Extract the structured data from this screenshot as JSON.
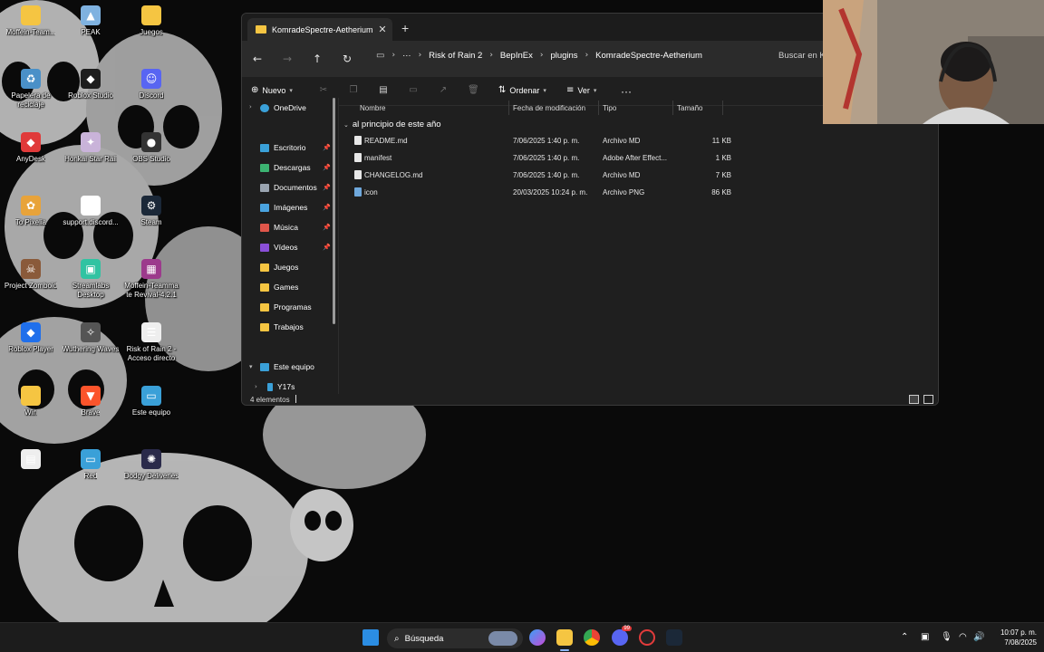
{
  "desktop": {
    "icons": [
      {
        "label": "Moffein-Team...",
        "color": "#f5c542",
        "glyph": ""
      },
      {
        "label": "PEAK",
        "color": "#7fb2e0",
        "glyph": "▲"
      },
      {
        "label": "Juegos",
        "color": "#f5c542",
        "glyph": ""
      },
      {
        "label": "Papelera de reciclaje",
        "color": "#4a90c8",
        "glyph": "♻"
      },
      {
        "label": "Roblox Studio",
        "color": "#1d1d1d",
        "glyph": "◆"
      },
      {
        "label": "Discord",
        "color": "#5865f2",
        "glyph": "☺"
      },
      {
        "label": "AnyDesk",
        "color": "#e03a3a",
        "glyph": "◆"
      },
      {
        "label": "Honkai Star Rail",
        "color": "#c9b3d9",
        "glyph": "✦"
      },
      {
        "label": "OBS Studio",
        "color": "#333333",
        "glyph": "●"
      },
      {
        "label": "To Pixelia",
        "color": "#e8a33a",
        "glyph": "✿"
      },
      {
        "label": "support.discord...",
        "color": "#ffffff",
        "glyph": "●"
      },
      {
        "label": "Steam",
        "color": "#1b2838",
        "glyph": "⚙"
      },
      {
        "label": "Project Zomboid",
        "color": "#8a5a3a",
        "glyph": "☠"
      },
      {
        "label": "Streamlabs Desktop",
        "color": "#31c3a2",
        "glyph": "▣"
      },
      {
        "label": "Moffein-Teamma te Revival-4.2.1",
        "color": "#9c3a8c",
        "glyph": "▦"
      },
      {
        "label": "Roblox Player",
        "color": "#1f6feb",
        "glyph": "◆"
      },
      {
        "label": "Wuthering Waves",
        "color": "#555555",
        "glyph": "✧"
      },
      {
        "label": "Risk of Rain 2 - Acceso directo",
        "color": "#eeeeee",
        "glyph": "☰"
      },
      {
        "label": "Win",
        "color": "#f5c542",
        "glyph": ""
      },
      {
        "label": "Brave",
        "color": "#fb542b",
        "glyph": "▼"
      },
      {
        "label": "Este equipo",
        "color": "#3aa0d8",
        "glyph": "▭"
      },
      {
        "label": "",
        "color": "#eeeeee",
        "glyph": "▤"
      },
      {
        "label": "Red",
        "color": "#3aa0d8",
        "glyph": "▭"
      },
      {
        "label": "Dodgy Deliveries",
        "color": "#2a2a4a",
        "glyph": "✺"
      }
    ]
  },
  "explorer": {
    "tab_title": "KomradeSpectre-Aetherium",
    "tab_close": "✕",
    "new_tab": "+",
    "breadcrumbs": [
      "Risk of Rain 2",
      "BepInEx",
      "plugins",
      "KomradeSpectre-Aetherium"
    ],
    "breadcrumb_more": "···",
    "search_placeholder": "Buscar en K",
    "toolbar": {
      "new_label": "Nuevo",
      "sort_label": "Ordenar",
      "view_label": "Ver",
      "more_label": "···"
    },
    "sidebar": {
      "onedrive": "OneDrive",
      "quick": [
        {
          "label": "Escritorio",
          "color": "#3aa0d8",
          "pinned": true
        },
        {
          "label": "Descargas",
          "color": "#3cb371",
          "pinned": true
        },
        {
          "label": "Documentos",
          "color": "#9aa4b0",
          "pinned": true
        },
        {
          "label": "Imágenes",
          "color": "#4aa3df",
          "pinned": true
        },
        {
          "label": "Música",
          "color": "#e0564a",
          "pinned": true
        },
        {
          "label": "Vídeos",
          "color": "#8a4fd8",
          "pinned": true
        },
        {
          "label": "Juegos",
          "color": "#f5c542",
          "pinned": false
        },
        {
          "label": "Games",
          "color": "#f5c542",
          "pinned": false
        },
        {
          "label": "Programas",
          "color": "#f5c542",
          "pinned": false
        },
        {
          "label": "Trabajos",
          "color": "#f5c542",
          "pinned": false
        }
      ],
      "this_pc": "Este equipo",
      "drive": "Y17s"
    },
    "columns": {
      "name": "Nombre",
      "date": "Fecha de modificación",
      "type": "Tipo",
      "size": "Tamaño"
    },
    "group_label": "al principio de este año",
    "files": [
      {
        "name": "README.md",
        "date": "7/06/2025 1:40 p. m.",
        "type": "Archivo MD",
        "size": "11 KB",
        "kind": "doc"
      },
      {
        "name": "manifest",
        "date": "7/06/2025 1:40 p. m.",
        "type": "Adobe After Effect...",
        "size": "1 KB",
        "kind": "doc"
      },
      {
        "name": "CHANGELOG.md",
        "date": "7/06/2025 1:40 p. m.",
        "type": "Archivo MD",
        "size": "7 KB",
        "kind": "doc"
      },
      {
        "name": "icon",
        "date": "20/03/2025 10:24 p. m.",
        "type": "Archivo PNG",
        "size": "86 KB",
        "kind": "png"
      }
    ],
    "status_count": "4 elementos"
  },
  "taskbar": {
    "search_label": "Búsqueda",
    "time": "10:07 p. m.",
    "date": "7/08/2025",
    "discord_badge": "99"
  }
}
